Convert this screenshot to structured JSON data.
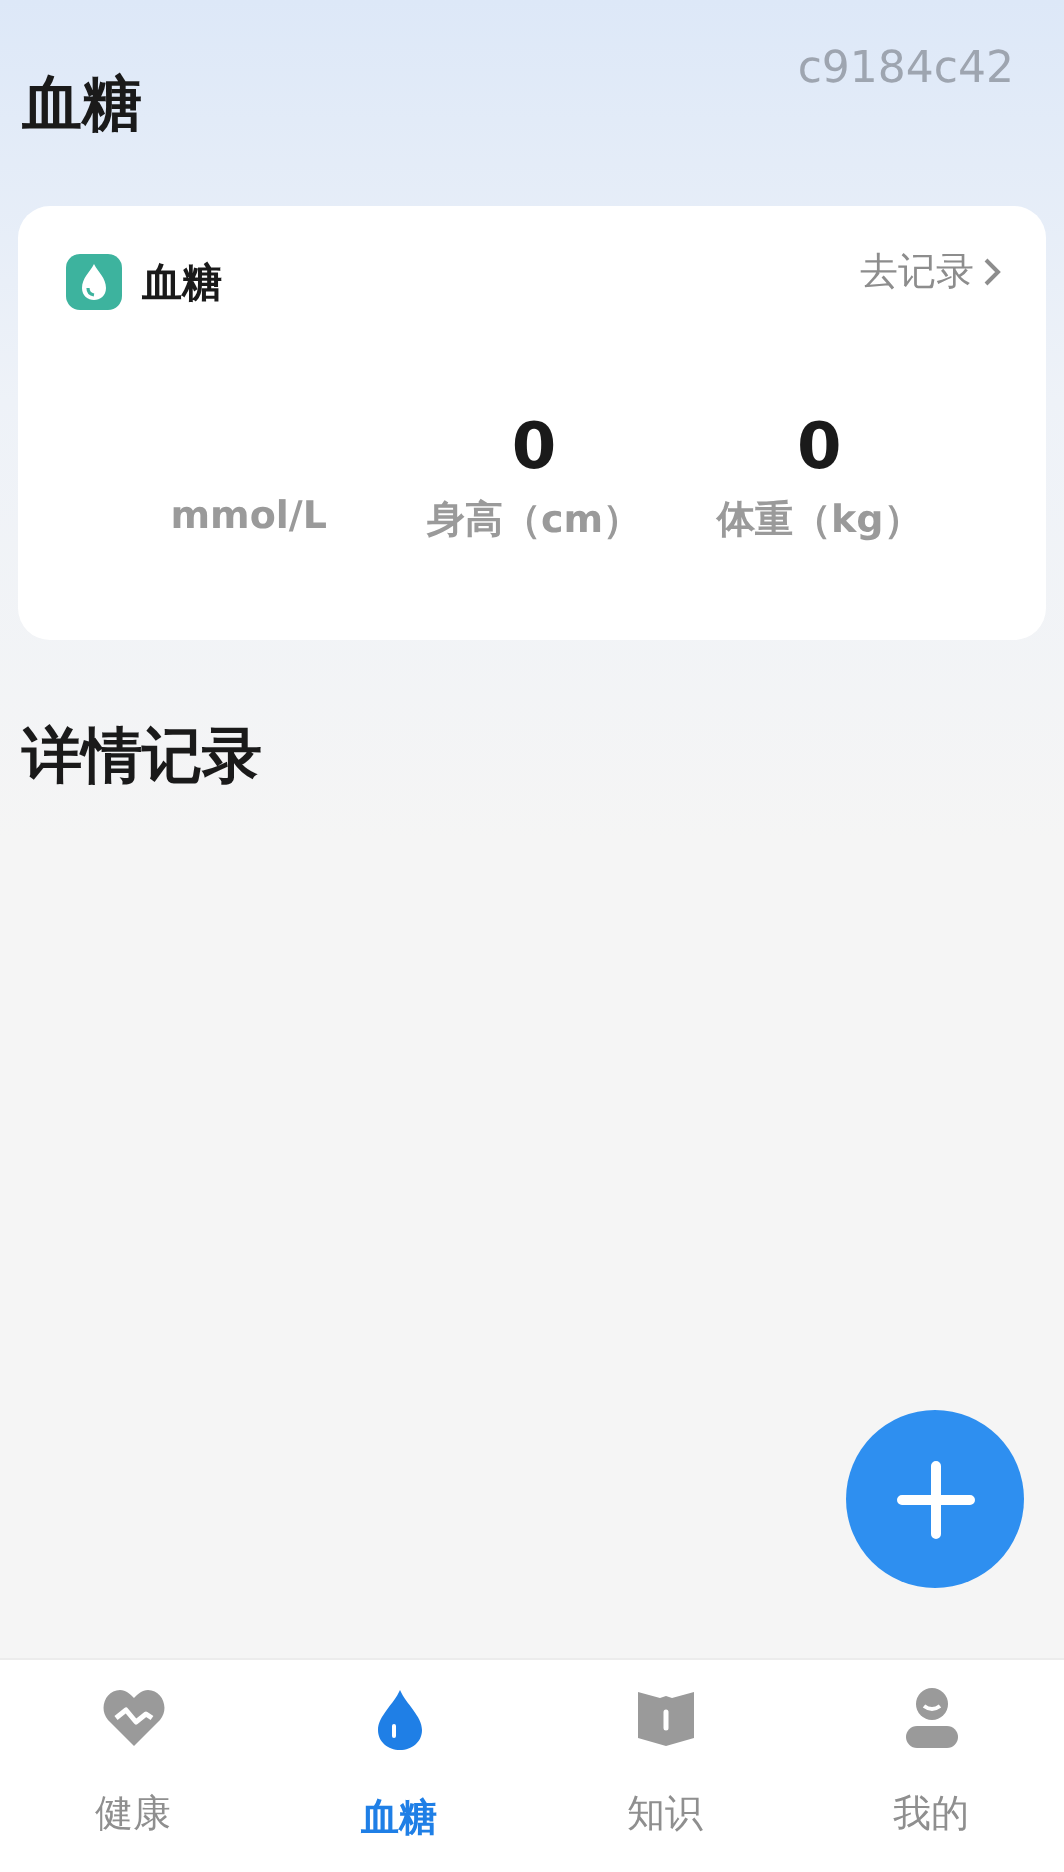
{
  "header": {
    "title": "血糖",
    "device_id": "c9184c42"
  },
  "card": {
    "title": "血糖",
    "link": "去记录",
    "stats": [
      {
        "unit": "mmol/L"
      },
      {
        "value": "0",
        "unit": "身高（cm）"
      },
      {
        "value": "0",
        "unit": "体重（kg）"
      }
    ]
  },
  "section_title": "详情记录",
  "tabs": [
    {
      "label": "健康",
      "selected": false
    },
    {
      "label": "血糖",
      "selected": true
    },
    {
      "label": "知识",
      "selected": false
    },
    {
      "label": "我的",
      "selected": false
    }
  ]
}
